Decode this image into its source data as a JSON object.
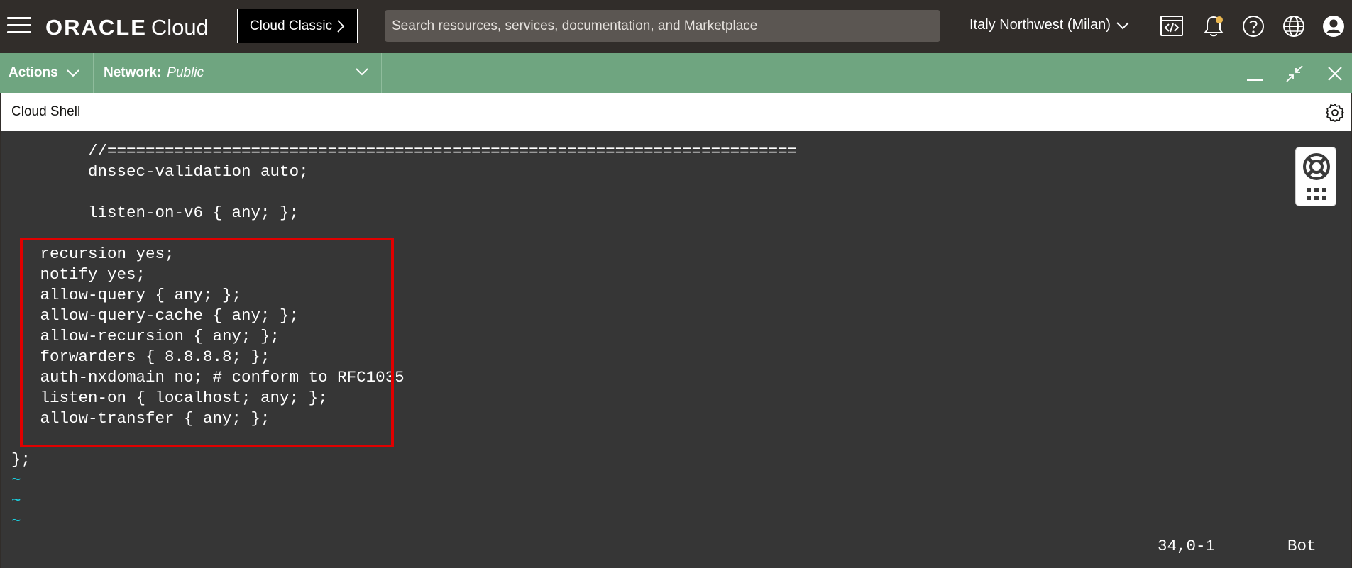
{
  "topbar": {
    "logo_brand": "ORACLE",
    "logo_product": "Cloud",
    "classic_button_label": "Cloud Classic",
    "search_placeholder": "Search resources, services, documentation, and Marketplace",
    "region_label": "Italy Northwest (Milan)",
    "icons": [
      "menu-icon",
      "developer-tools-icon",
      "notifications-bell-icon",
      "help-icon",
      "language-globe-icon",
      "profile-icon"
    ]
  },
  "actionbar": {
    "actions_label": "Actions",
    "network_label": "Network:",
    "network_value": "Public"
  },
  "shell": {
    "title": "Cloud Shell"
  },
  "terminal": {
    "lines": [
      "        //========================================================================",
      "        dnssec-validation auto;",
      "",
      "        listen-on-v6 { any; };",
      "",
      "   recursion yes;",
      "   notify yes;",
      "   allow-query { any; };",
      "   allow-query-cache { any; };",
      "   allow-recursion { any; };",
      "   forwarders { 8.8.8.8; };",
      "   auth-nxdomain no; # conform to RFC1035",
      "   listen-on { localhost; any; };",
      "   allow-transfer { any; };",
      "",
      "};"
    ],
    "tildes": [
      "~",
      "~",
      "~"
    ],
    "cursor_position": "34,0-1",
    "scroll_position": "Bot"
  },
  "colors": {
    "topbar_bg": "#312d2a",
    "actionbar_bg": "#6fa580",
    "terminal_bg": "#363636",
    "highlight_border": "#e00000",
    "tilde": "#1ad7e8"
  }
}
